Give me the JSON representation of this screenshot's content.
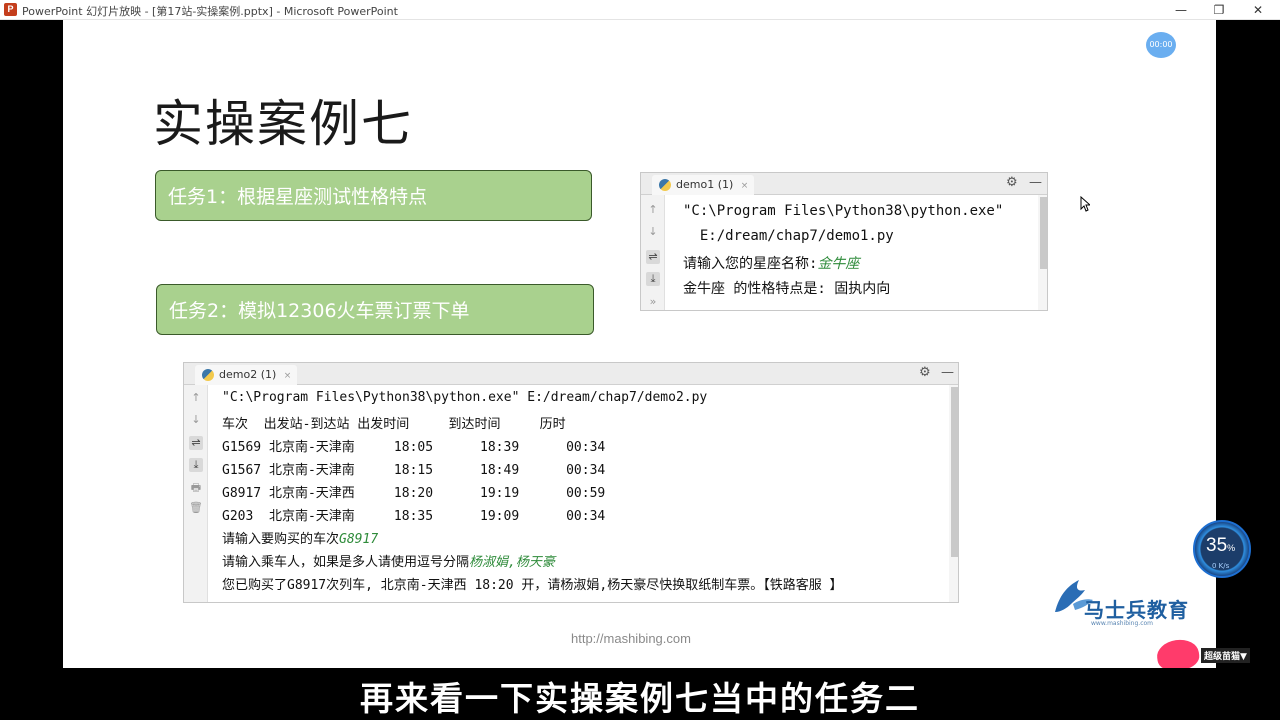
{
  "window": {
    "title": "PowerPoint 幻灯片放映 - [第17站-实操案例.pptx] - Microsoft PowerPoint",
    "app_icon": "P",
    "minimize": "—",
    "restore": "❐",
    "close": "✕"
  },
  "timer": "00:00",
  "slide": {
    "title": "实操案例七",
    "task1": "任务1：根据星座测试性格特点",
    "task2": "任务2：模拟12306火车票订票下单",
    "url": "http://mashibing.com"
  },
  "demo1": {
    "tab_label": "demo1 (1)",
    "tab_close": "×",
    "gear_icon": "⚙",
    "minimize_icon": "—",
    "gutter_icons": [
      "↑",
      "↓",
      "⇌",
      "⤓",
      "»"
    ],
    "lines": {
      "cmd1": "\"C:\\Program Files\\Python38\\python.exe\"",
      "cmd2": "  E:/dream/chap7/demo1.py",
      "prompt": "请输入您的星座名称:",
      "input": "金牛座",
      "result": "金牛座 的性格特点是: 固执内向"
    }
  },
  "demo2": {
    "tab_label": "demo2 (1)",
    "tab_close": "×",
    "gear_icon": "⚙",
    "minimize_icon": "—",
    "gutter_icons": [
      "↑",
      "↓",
      "⇌",
      "⤓",
      "🖶",
      "🗑"
    ],
    "cmd": "\"C:\\Program Files\\Python38\\python.exe\" E:/dream/chap7/demo2.py",
    "header": "车次  出发站-到达站 出发时间     到达时间     历时",
    "rows": [
      "G1569 北京南-天津南     18:05      18:39      00:34",
      "G1567 北京南-天津南     18:15      18:49      00:34",
      "G8917 北京南-天津西     18:20      19:19      00:59",
      "G203  北京南-天津南     18:35      19:09      00:34"
    ],
    "prompt_train": "请输入要购买的车次",
    "input_train": "G8917",
    "prompt_passenger": "请输入乘车人，如果是多人请使用逗号分隔",
    "input_passenger": "杨淑娟,杨天豪",
    "result": "您已购买了G8917次列车, 北京南-天津西 18:20 开，请杨淑娟,杨天豪尽快换取纸制车票。【铁路客服 】"
  },
  "logo": {
    "text": "马士兵教育",
    "sub": "www.mashibing.com"
  },
  "gauge": {
    "percent": "35",
    "percent_sign": "%",
    "speed": "0 K/s"
  },
  "badge": {
    "text": "超级苗猫▼"
  },
  "subtitle": "再来看一下实操案例七当中的任务二",
  "colors": {
    "task_fill": "#a9d18e",
    "task_border": "#3a5a2a",
    "green_input": "#2e8b3a",
    "subtitle_bg": "#000000"
  }
}
